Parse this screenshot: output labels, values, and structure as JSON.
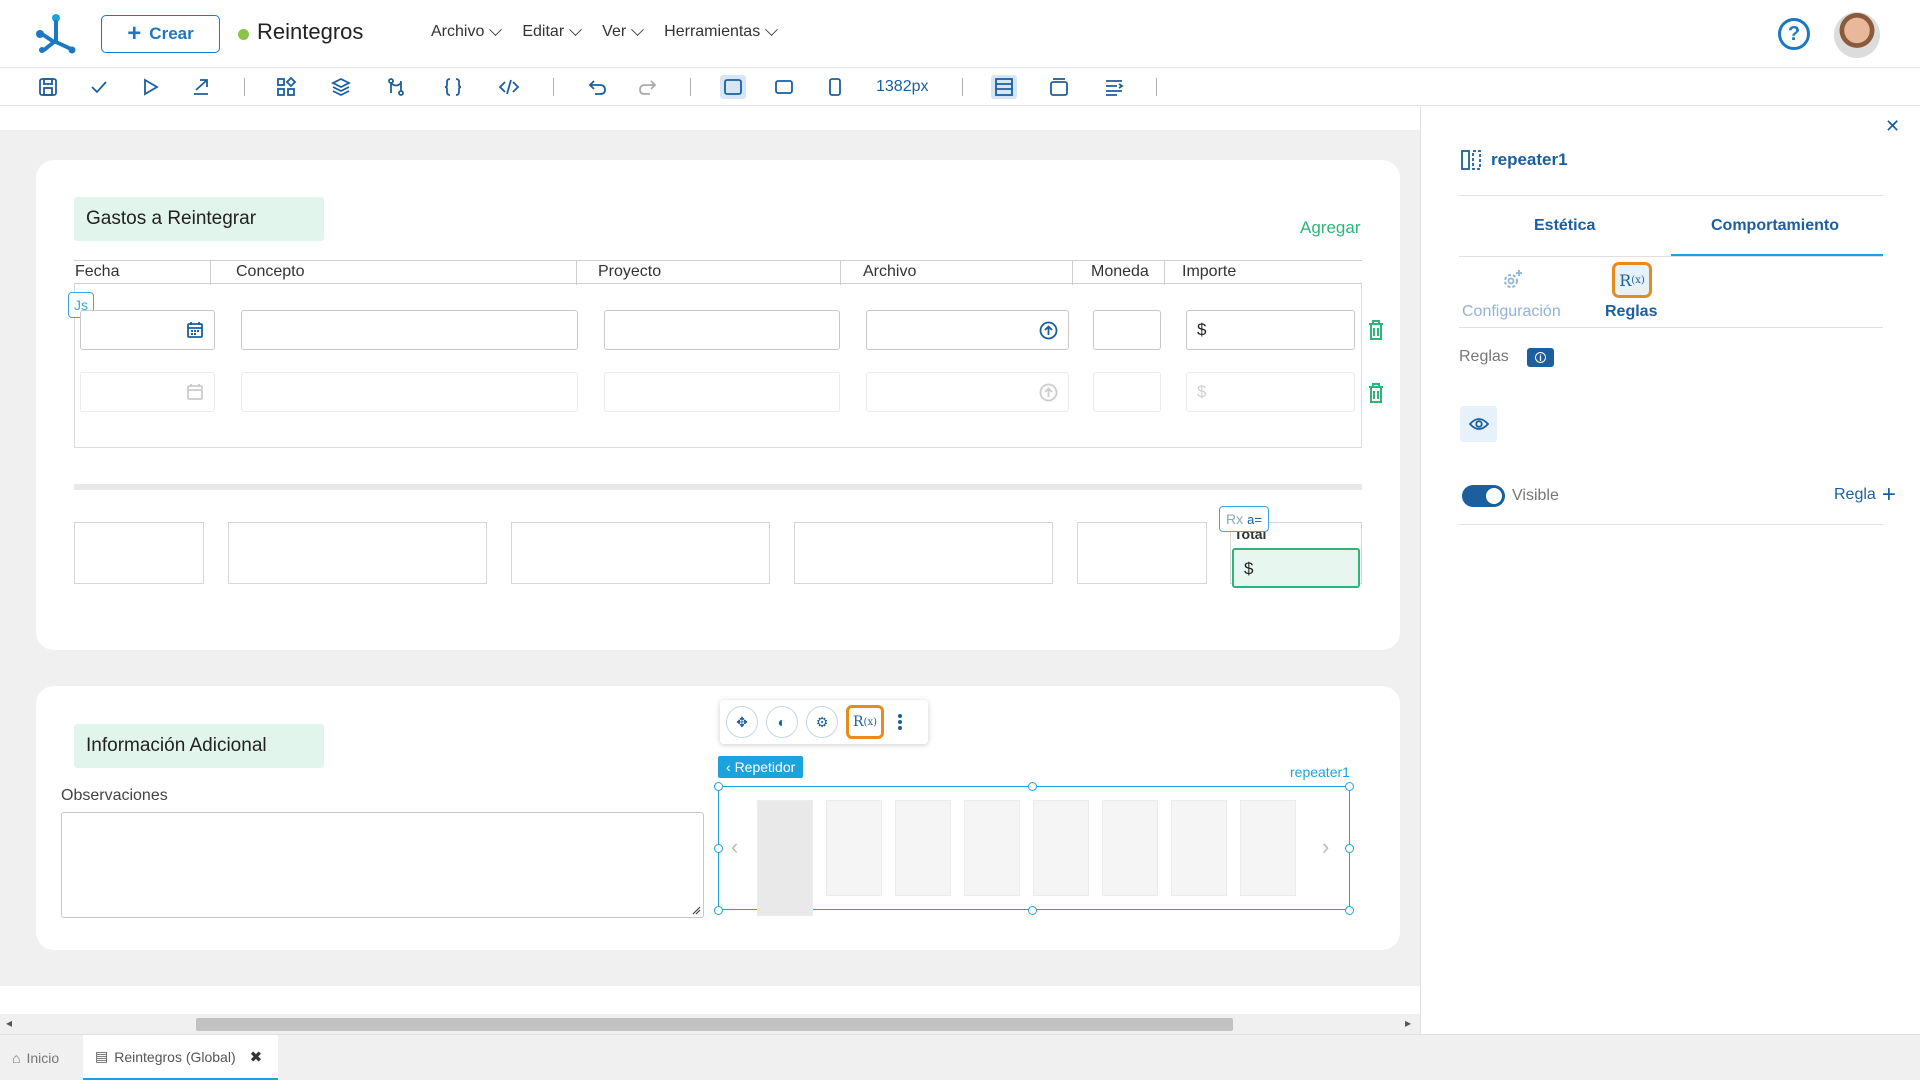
{
  "header": {
    "crear_label": "Crear",
    "app_title": "Reintegros",
    "menus": [
      "Archivo",
      "Editar",
      "Ver",
      "Herramientas"
    ],
    "status_color": "#8bc34a",
    "accent_color": "#1b78c4"
  },
  "toolbar": {
    "width_label": "1382px",
    "icons": [
      "save-icon",
      "check-icon",
      "play-icon",
      "export-icon",
      "widgets-icon",
      "layers-icon",
      "flow-icon",
      "braces-icon",
      "code-icon",
      "undo-icon",
      "redo-icon",
      "desktop-view-icon",
      "tablet-view-icon",
      "mobile-view-icon",
      "layout-icon",
      "window-icon",
      "align-icon"
    ]
  },
  "gastos": {
    "title": "Gastos a Reintegrar",
    "add_label": "Agregar",
    "columns": [
      "Fecha",
      "Concepto",
      "Proyecto",
      "Archivo",
      "Moneda",
      "Importe"
    ],
    "currency_symbol": "$",
    "js_badge": "Js",
    "total_label": "Total",
    "total_value": "$",
    "rx_badge": "Rx"
  },
  "info": {
    "title": "Información Adicional",
    "obs_label": "Observaciones",
    "repeater_tag": "Repetidor",
    "repeater_name": "repeater1",
    "rules_button_label": "R(x)"
  },
  "panel": {
    "title": "repeater1",
    "tabs": [
      "Estética",
      "Comportamiento"
    ],
    "subtabs": [
      "Configuración",
      "Reglas"
    ],
    "reglas_label": "Reglas",
    "visible_label": "Visible",
    "add_rule_label": "Regla"
  },
  "bottom_tabs": {
    "home_label": "Inicio",
    "active_label": "Reintegros (Global)"
  }
}
